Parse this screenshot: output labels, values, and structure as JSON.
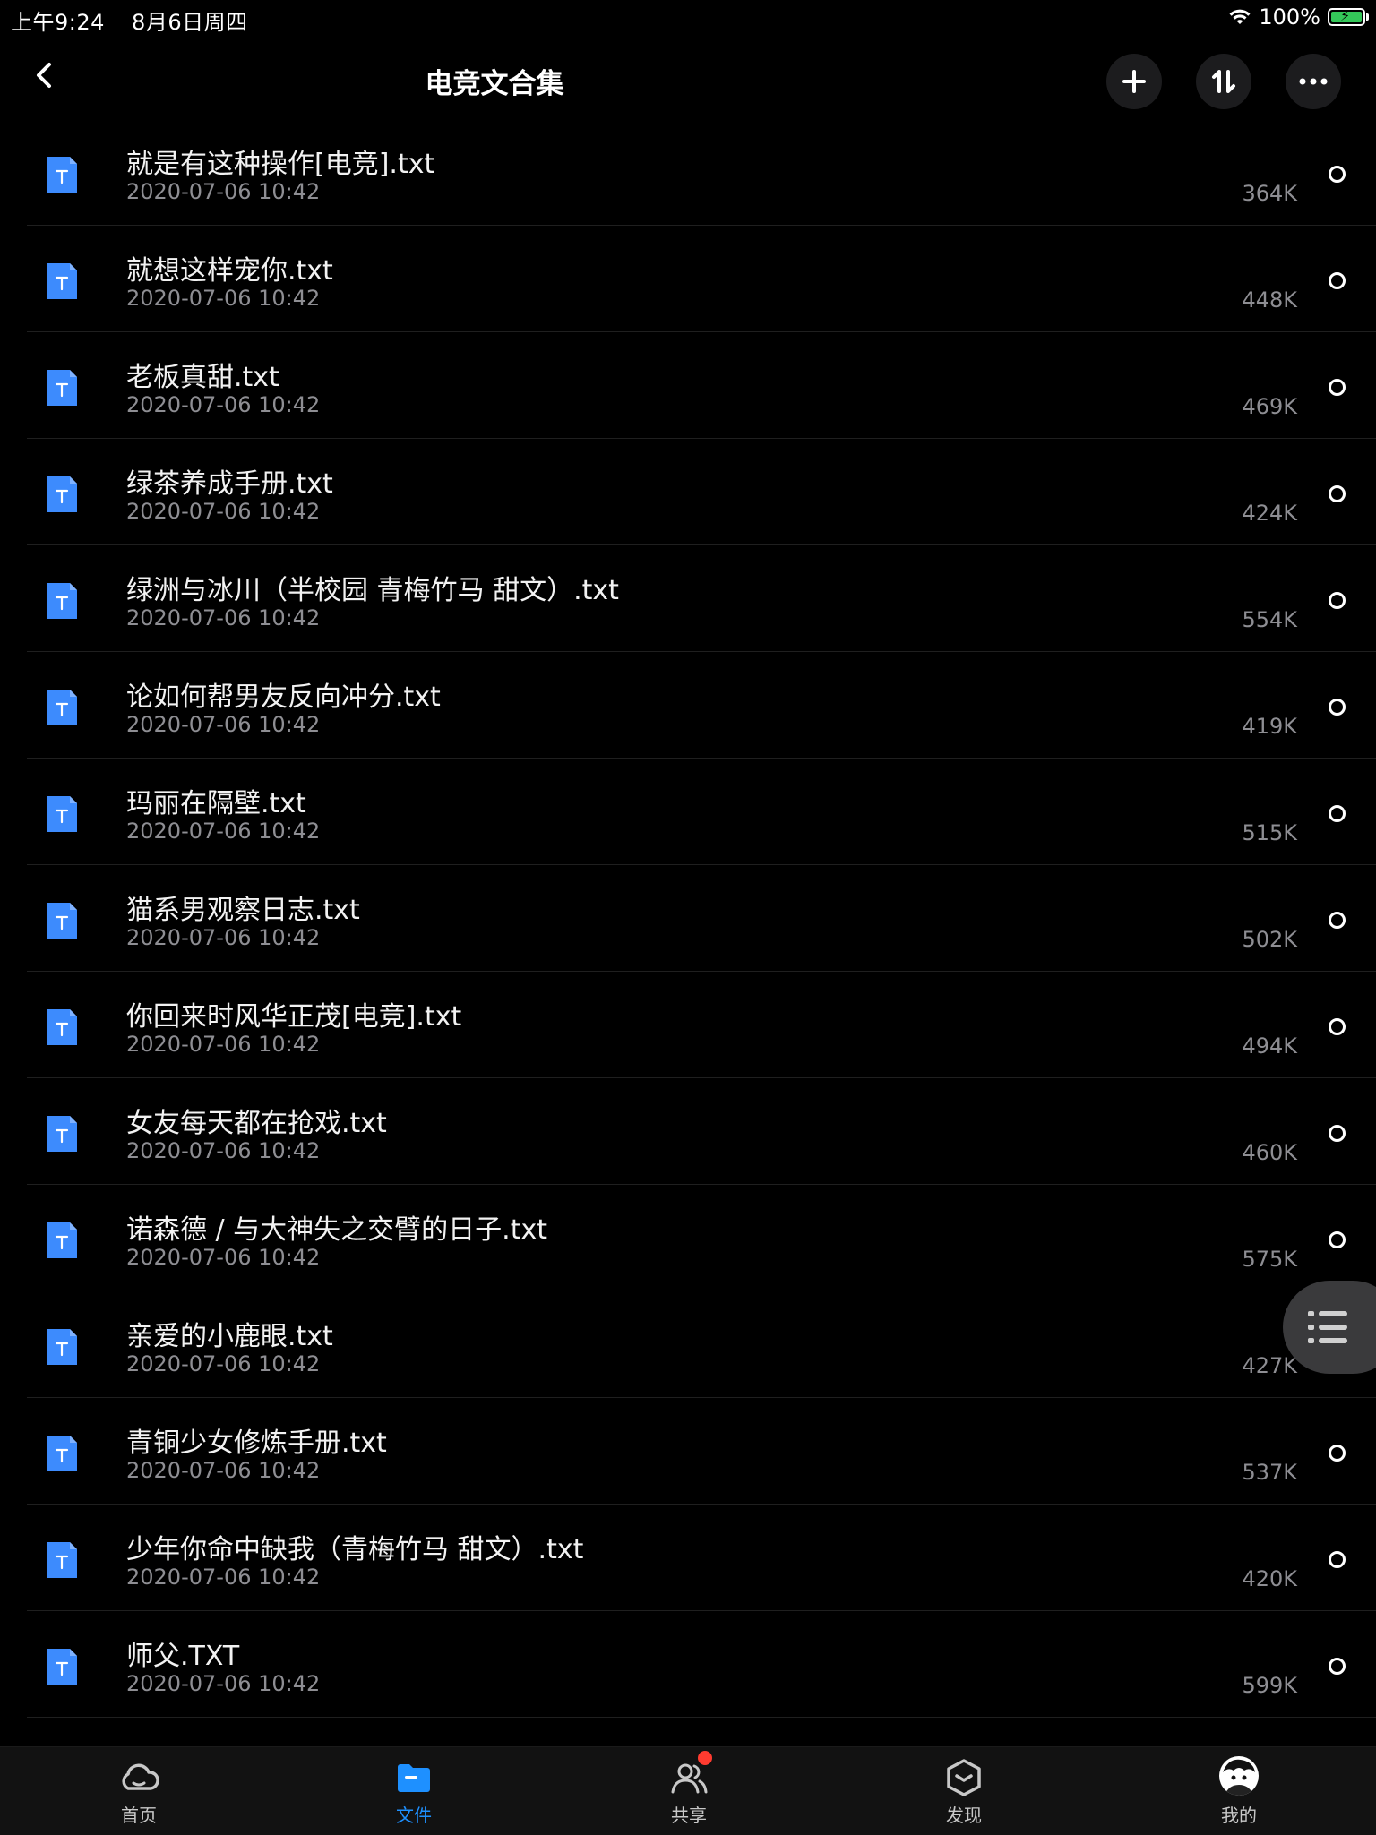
{
  "status_bar": {
    "time": "上午9:24",
    "date": "8月6日周四",
    "battery": "100%"
  },
  "nav": {
    "title": "电竞文合集"
  },
  "files": [
    {
      "name": "就是有这种操作[电竞].txt",
      "date": "2020-07-06 10:42",
      "size": "364K"
    },
    {
      "name": "就想这样宠你.txt",
      "date": "2020-07-06 10:42",
      "size": "448K"
    },
    {
      "name": "老板真甜.txt",
      "date": "2020-07-06 10:42",
      "size": "469K"
    },
    {
      "name": "绿茶养成手册.txt",
      "date": "2020-07-06 10:42",
      "size": "424K"
    },
    {
      "name": "绿洲与冰川（半校园 青梅竹马 甜文）.txt",
      "date": "2020-07-06 10:42",
      "size": "554K"
    },
    {
      "name": "论如何帮男友反向冲分.txt",
      "date": "2020-07-06 10:42",
      "size": "419K"
    },
    {
      "name": "玛丽在隔壁.txt",
      "date": "2020-07-06 10:42",
      "size": "515K"
    },
    {
      "name": "猫系男观察日志.txt",
      "date": "2020-07-06 10:42",
      "size": "502K"
    },
    {
      "name": "你回来时风华正茂[电竞].txt",
      "date": "2020-07-06 10:42",
      "size": "494K"
    },
    {
      "name": "女友每天都在抢戏.txt",
      "date": "2020-07-06 10:42",
      "size": "460K"
    },
    {
      "name": "诺森德 / 与大神失之交臂的日子.txt",
      "date": "2020-07-06 10:42",
      "size": "575K"
    },
    {
      "name": "亲爱的小鹿眼.txt",
      "date": "2020-07-06 10:42",
      "size": "427K"
    },
    {
      "name": "青铜少女修炼手册.txt",
      "date": "2020-07-06 10:42",
      "size": "537K"
    },
    {
      "name": "少年你命中缺我（青梅竹马 甜文）.txt",
      "date": "2020-07-06 10:42",
      "size": "420K"
    },
    {
      "name": "师父.TXT",
      "date": "2020-07-06 10:42",
      "size": "599K"
    }
  ],
  "tabs": [
    {
      "label": "首页",
      "icon": "cloud-icon"
    },
    {
      "label": "文件",
      "icon": "folder-icon"
    },
    {
      "label": "共享",
      "icon": "people-icon"
    },
    {
      "label": "发现",
      "icon": "discover-icon"
    },
    {
      "label": "我的",
      "icon": "avatar"
    }
  ],
  "colors": {
    "accent": "#1e90ff",
    "file_icon": "#3d8bfd",
    "badge": "#ff3b30"
  }
}
